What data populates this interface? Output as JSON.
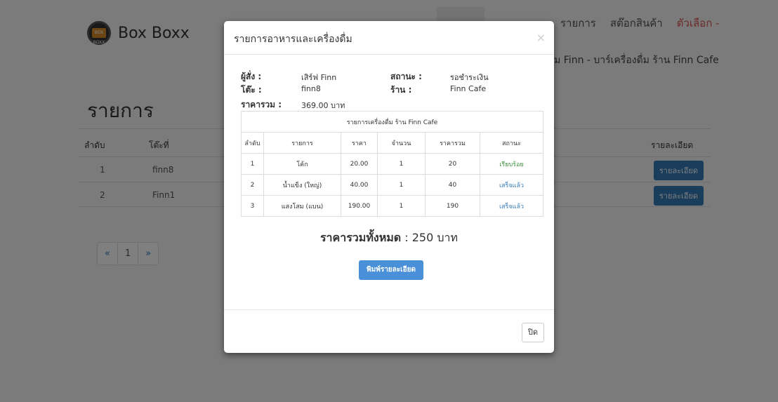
{
  "brand": {
    "name": "Box Boxx",
    "logo_text": "BOX BOXX"
  },
  "nav": {
    "items": [
      "รายการ",
      "สต๊อกสินค้า"
    ],
    "options": "ตัวเลือก -"
  },
  "subtitle": "ดื่ม Finn - บาร์เครื่องดื่ม ร้าน Finn Cafe",
  "page_title": "รายการ",
  "bg_table": {
    "headers": {
      "index": "ลำดับ",
      "table": "โต๊ะที่",
      "detail": "รายละเอียด"
    },
    "rows": [
      {
        "index": "1",
        "table": "finn8",
        "button": "รายละเอียด"
      },
      {
        "index": "2",
        "table": "Finn1",
        "button": "รายละเอียด"
      }
    ]
  },
  "pager": {
    "prev": "«",
    "page": "1",
    "next": "»"
  },
  "modal": {
    "title": "รายการอาหารและเครื่องดื่ม",
    "close_icon": "×",
    "orderer_label": "ผู้สั่ง :",
    "orderer_value": "เสิร์ฟ Finn",
    "status_label": "สถานะ :",
    "status_value": "รอชำระเงิน",
    "table_label": "โต๊ะ :",
    "table_value": "finn8",
    "shop_label": "ร้าน :",
    "shop_value": "Finn Cafe",
    "sum_label": "ราคารวม :",
    "sum_value": "369.00 บาท",
    "inner_caption": "รายการเครื่องดื่ม ร้าน Finn Cafe",
    "columns": [
      "ลำดับ",
      "รายการ",
      "ราคา",
      "จำนวน",
      "ราคารวม",
      "สถานะ"
    ],
    "rows": [
      [
        "1",
        "โค้ก",
        "20.00",
        "1",
        "20",
        "เรียบร้อย"
      ],
      [
        "2",
        "น้ำแข็ง (ใหญ่)",
        "40.00",
        "1",
        "40",
        "เสร็จแล้ว"
      ],
      [
        "3",
        "แสงโสม (แบน)",
        "190.00",
        "1",
        "190",
        "เสร็จแล้ว"
      ]
    ],
    "total_label": "ราคารวมทั้งหมด",
    "total_value": ": 250 บาท",
    "print_button": "พิมพ์รายละเอียด",
    "close_button": "ปิด"
  },
  "colors": {
    "accent": "#337ab7",
    "danger": "#d9534f",
    "success": "#3c8d3c"
  }
}
